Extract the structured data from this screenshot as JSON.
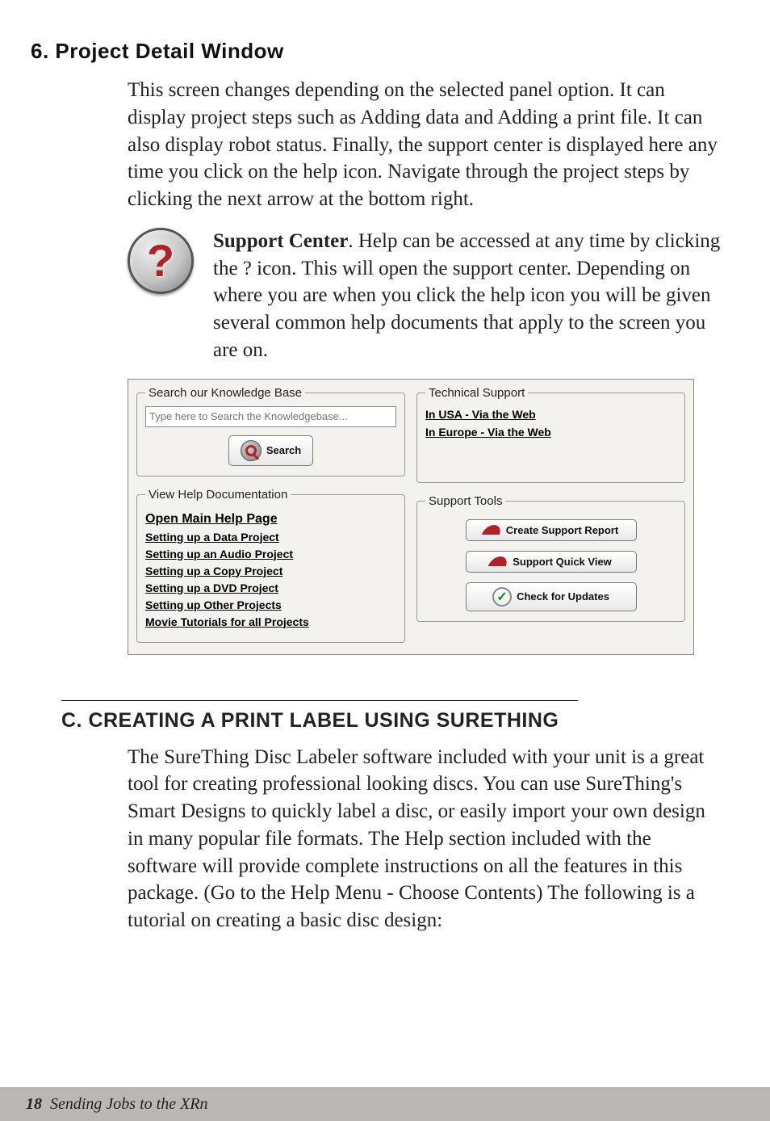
{
  "section6": {
    "heading": "6. Project Detail Window",
    "para": "This screen changes depending on the selected panel option. It can display project steps such as Adding data and Adding a print file. It can also display robot status. Finally, the support center is displayed here any time you click on the help icon. Navigate through the project steps by clicking the next arrow at the bottom right.",
    "support_bold": "Support Center",
    "support_text": ". Help can be accessed at any time by clicking the ? icon. This will open the support center. Depending on where you are when you click the help icon you will be given several common help documents that apply to the screen you are on."
  },
  "panel": {
    "kb": {
      "legend": "Search our Knowledge Base",
      "placeholder": "Type here to Search the Knowledgebase...",
      "search_btn": "Search"
    },
    "docs": {
      "legend": "View Help Documentation",
      "links": [
        "Open Main Help Page",
        "Setting up a Data Project",
        "Setting up an Audio Project",
        "Setting up a Copy Project",
        "Setting up a DVD Project",
        "Setting up Other Projects",
        "Movie Tutorials for all Projects"
      ]
    },
    "tech": {
      "legend": "Technical Support",
      "links": [
        "In USA - Via the Web",
        "In Europe - Via the Web"
      ]
    },
    "tools": {
      "legend": "Support Tools",
      "buttons": [
        "Create Support Report",
        "Support Quick View",
        "Check for Updates"
      ]
    }
  },
  "sectionC": {
    "heading": "C. CREATING A PRINT LABEL USING SURETHING",
    "para": "The SureThing Disc Labeler software included with your unit is a great tool for creating professional looking discs. You can use SureThing's Smart Designs to quickly label a disc, or easily import your own design in many popular file formats. The Help section included with the software will provide complete instructions on all the features in this package. (Go to the Help Menu - Choose Contents) The following is a tutorial on creating a basic disc design:"
  },
  "footer": {
    "page": "18",
    "title": "Sending Jobs to the XRn"
  }
}
